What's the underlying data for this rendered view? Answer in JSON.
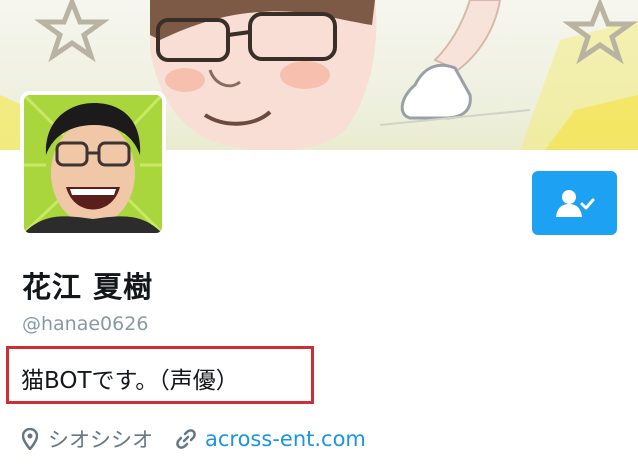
{
  "profile": {
    "display_name": "花江 夏樹",
    "handle": "@hanae0626",
    "bio": "猫BOTです。（声優）",
    "location": "シオシシオ",
    "website": "across-ent.com"
  },
  "icons": {
    "location": "map-pin-icon",
    "website": "link-icon",
    "follow": "following-user-check-icon"
  },
  "colors": {
    "accent": "#1da1f2",
    "link": "#1b95e0",
    "highlight_box": "#cc2e33",
    "avatar_background": "#a9d63c"
  }
}
